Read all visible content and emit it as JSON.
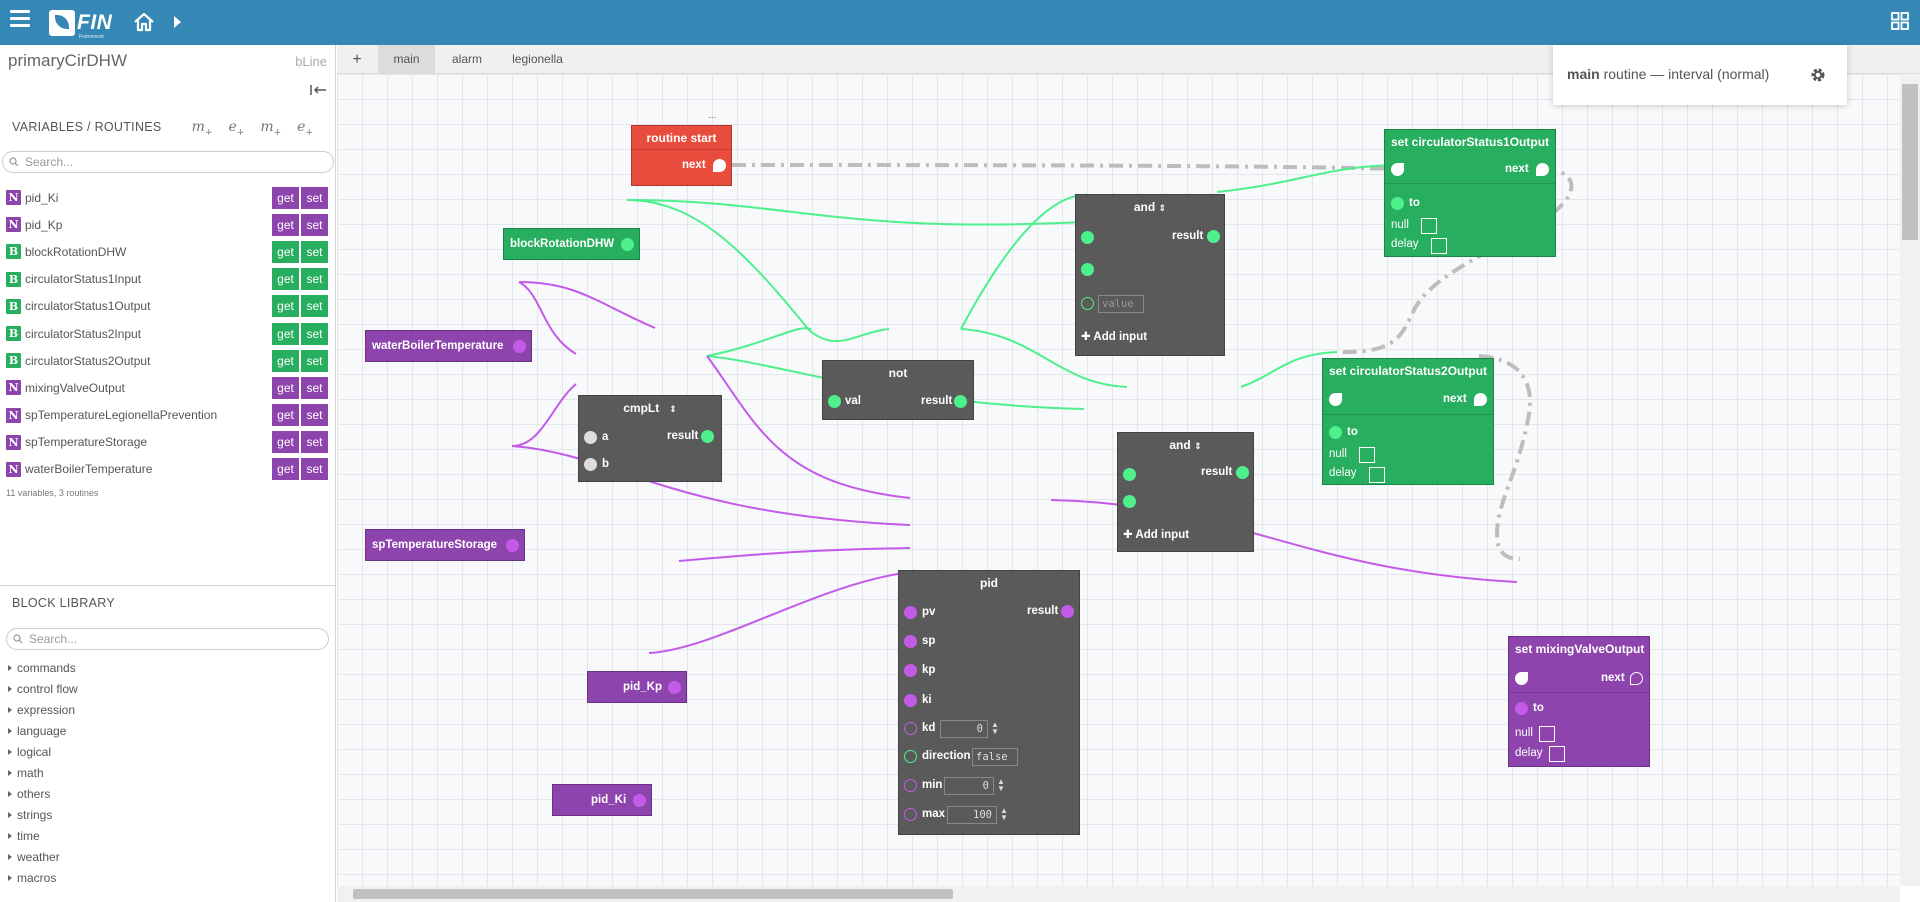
{
  "app": {
    "logo": "FIN",
    "logo_sub": "Framework"
  },
  "sidebar": {
    "project": "primaryCirDHW",
    "badge": "bLine",
    "vars_title": "VARIABLES / ROUTINES",
    "var_tools": [
      {
        "label": "m",
        "sub": "+"
      },
      {
        "label": "e",
        "sub": "+"
      },
      {
        "label": "m",
        "sub": "+"
      },
      {
        "label": "e",
        "sub": "+"
      }
    ],
    "search_placeholder": "Search...",
    "variables": [
      {
        "type": "N",
        "name": "pid_Ki"
      },
      {
        "type": "N",
        "name": "pid_Kp"
      },
      {
        "type": "B",
        "name": "blockRotationDHW"
      },
      {
        "type": "B",
        "name": "circulatorStatus1Input"
      },
      {
        "type": "B",
        "name": "circulatorStatus1Output"
      },
      {
        "type": "B",
        "name": "circulatorStatus2Input"
      },
      {
        "type": "B",
        "name": "circulatorStatus2Output"
      },
      {
        "type": "N",
        "name": "mixingValveOutput"
      },
      {
        "type": "N",
        "name": "spTemperatureLegionellaPrevention"
      },
      {
        "type": "N",
        "name": "spTemperatureStorage"
      },
      {
        "type": "N",
        "name": "waterBoilerTemperature"
      }
    ],
    "get_label": "get",
    "set_label": "set",
    "count": "11 variables, 3 routines",
    "library_title": "BLOCK LIBRARY",
    "library_search": "Search...",
    "library": [
      "commands",
      "control flow",
      "expression",
      "language",
      "logical",
      "math",
      "others",
      "strings",
      "time",
      "weather",
      "macros"
    ]
  },
  "tabs": {
    "add": "+",
    "items": [
      "main",
      "alarm",
      "legionella"
    ],
    "active": "main"
  },
  "routine_box": {
    "name": "main",
    "desc": "routine — interval (normal)"
  },
  "blocks": {
    "routine_start": {
      "title": "routine start",
      "next": "next",
      "dots": "..."
    },
    "set_circ1": {
      "title": "set circulatorStatus1Output",
      "next": "next",
      "to": "to",
      "null": "null",
      "delay": "delay"
    },
    "set_circ2": {
      "title": "set circulatorStatus2Output",
      "next": "next",
      "to": "to",
      "null": "null",
      "delay": "delay"
    },
    "set_mixing": {
      "title": "set mixingValveOutput",
      "next": "next",
      "to": "to",
      "null": "null",
      "delay": "delay"
    },
    "and1": {
      "title": "and",
      "result": "result",
      "placeholder": "value",
      "add": "Add input"
    },
    "and2": {
      "title": "and",
      "result": "result",
      "add": "Add input"
    },
    "not": {
      "title": "not",
      "val": "val",
      "result": "result"
    },
    "cmplt": {
      "title": "cmpLt",
      "a": "a",
      "b": "b",
      "result": "result"
    },
    "pid": {
      "title": "pid",
      "pv": "pv",
      "sp": "sp",
      "kp": "kp",
      "ki": "ki",
      "kd": "kd",
      "kd_val": "0",
      "direction": "direction",
      "direction_val": "false",
      "min": "min",
      "min_val": "0",
      "max": "max",
      "max_val": "100",
      "result": "result"
    },
    "var_blockRotation": "blockRotationDHW",
    "var_waterBoiler": "waterBoilerTemperature",
    "var_spStorage": "spTemperatureStorage",
    "var_pidKp": "pid_Kp",
    "var_pidKi": "pid_Ki"
  },
  "colors": {
    "topbar": "#3588b5",
    "numeric": "#8e44ad",
    "boolean": "#27ae5f",
    "button_get_set_num": "#8e44ad",
    "button_get_set_bool": "#27ae5f",
    "wire_bool": "#4ef08c",
    "wire_num": "#c45be8",
    "wire_flow": "#bdbdbd"
  }
}
